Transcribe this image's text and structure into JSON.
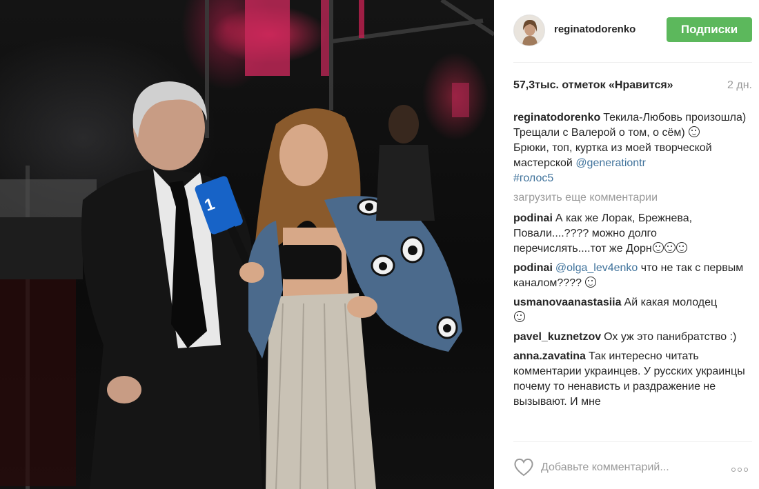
{
  "post": {
    "username": "reginatodorenko",
    "follow_label": "Подписки",
    "likes": "57,3тыс. отметок «Нравится»",
    "time_ago": "2 дн.",
    "caption": {
      "username": "reginatodorenko",
      "text": "Текила-Любовь произошла)\nТрещали с Валерой о том, о сём)",
      "text2": "\nБрюки, топ, куртка из моей творческой мастерской ",
      "mention": "@generationtr",
      "hashtag": "#голос5"
    },
    "load_more": "загрузить еще комментарии",
    "comments": [
      {
        "user": "podinai",
        "text": "А как же Лорак, Брежнева, Повали....???? можно долго перечислять....тот же Дорн",
        "emoji_count": 3
      },
      {
        "user": "podinai",
        "mention": "@olga_lev4enko",
        "text": "что не так с первым каналом????",
        "emoji_count": 1
      },
      {
        "user": "usmanovaanastasiia",
        "text": "Ай какая молодец",
        "emoji_count": 1
      },
      {
        "user": "pavel_kuznetzov",
        "text": "Ох уж это панибратство :)",
        "emoji_count": 0
      },
      {
        "user": "anna.zavatina",
        "text": "Так интересно читать комментарии украинцев. У русских украинцы почему то ненависть и раздражение не вызывают. И мне",
        "emoji_count": 0
      }
    ],
    "comment_placeholder": "Добавьте комментарий...",
    "icons": {
      "heart": "heart-icon",
      "more": "more-options-icon",
      "emoji": "smiling-face-icon"
    },
    "colors": {
      "follow_button": "#5cb85c",
      "link": "#3f729b",
      "muted": "#999999",
      "text": "#262626"
    }
  }
}
